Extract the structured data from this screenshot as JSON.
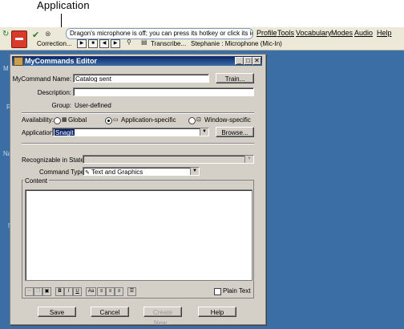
{
  "annotation": {
    "label": "Application"
  },
  "dragon_bar": {
    "message": "Dragon's microphone is off; you can press its hotkey or click its icon to tur...",
    "menus": [
      "Profile",
      "Tools",
      "Vocabulary",
      "Modes",
      "Audio",
      "Help"
    ],
    "correction_label": "Correction...",
    "transcribe_label": "Transcribe...",
    "user_status": "Stephanie : Microphone (Mic-In)"
  },
  "dialog": {
    "title": "MyCommands Editor",
    "command_name_label": "MyCommand Name:",
    "command_name_value": "Catalog sent",
    "train_label": "Train...",
    "description_label": "Description:",
    "description_value": "",
    "group_label": "Group:",
    "group_value": "User-defined",
    "availability_label": "Availability:",
    "availability_options": [
      "Global",
      "Application-specific",
      "Window-specific"
    ],
    "availability_selected": "Application-specific",
    "application_label": "Application:",
    "application_value": "Snagit",
    "browse_label": "Browse...",
    "recognizable_label": "Recognizable in States:",
    "recognizable_value": "",
    "command_type_label": "Command Type:",
    "command_type_value": "Text and Graphics",
    "content_label": "Content",
    "format_buttons": [
      "B",
      "I",
      "U",
      "Aa"
    ],
    "plain_text_label": "Plain Text",
    "plain_text_checked": false,
    "save_label": "Save",
    "cancel_label": "Cancel",
    "create_new_label": "Create New...",
    "help_label": "Help"
  }
}
